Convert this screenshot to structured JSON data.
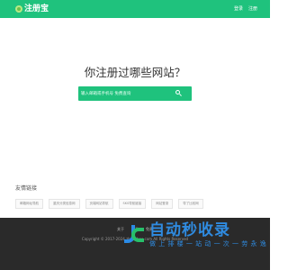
{
  "header": {
    "logo_text": "注册宝",
    "links": [
      "登录",
      "注册"
    ]
  },
  "hero": {
    "headline": "你注册过哪些网站？",
    "search_placeholder": "输入邮箱或手机号 免费查询"
  },
  "friends": {
    "title": "友情链接",
    "links": [
      "邮箱网址导航",
      "重庆分类信息网",
      "页端网站导航",
      "SKS导航链接",
      "网站登录",
      "导了比较网"
    ]
  },
  "footer": {
    "links": [
      "关于",
      "联系",
      "免责"
    ],
    "copyright": "Copyright © 2017-2024 zhucebao.com All Rights Reserved"
  },
  "watermark": {
    "title": "自动秒收录",
    "subtitle": "做 上 排 楼 一 站 动 一 次 一 劳 永 逸"
  },
  "colors": {
    "brand": "#1fc27d",
    "footer_bg": "#2a2a2a",
    "watermark": "#2f8be0"
  }
}
